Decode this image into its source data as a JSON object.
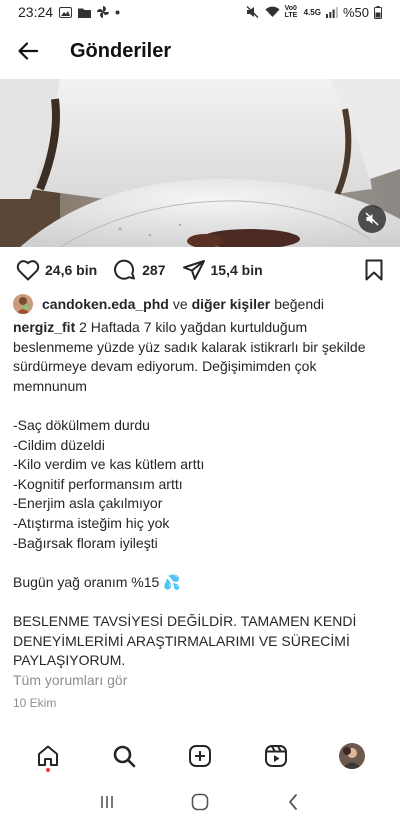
{
  "status_bar": {
    "time": "23:24",
    "carrier_label": "Vo0 LTE",
    "network": "4.5G",
    "battery": "%50"
  },
  "header": {
    "title": "Gönderiler"
  },
  "actions": {
    "likes": "24,6 bin",
    "comments": "287",
    "shares": "15,4 bin"
  },
  "likes_line": {
    "user": "candoken.eda_phd",
    "conjunction": "ve",
    "others": "diğer kişiler",
    "suffix": "beğendi"
  },
  "caption": {
    "username": "nergiz_fit",
    "text": " 2 Haftada 7 kilo yağdan kurtulduğum beslenmeme yüzde yüz sadık kalarak istikrarlı bir şekilde sürdürmeye devam ediyorum. Değişimimden çok memnunum\n\n-Saç dökülmem durdu\n-Cildim düzeldi\n-Kilo verdim ve kas kütlem arttı\n-Kognitif performansım arttı\n-Enerjim asla çakılmıyor\n-Atıştırma isteğim hiç yok\n-Bağırsak floram iyileşti\n\nBugün yağ oranım %15 💦\n\nBESLENME TAVSİYESİ DEĞİLDİR. TAMAMEN KENDİ DENEYİMLERİMİ ARAŞTIRMALARIMI VE SÜRECİMİ PAYLAŞIYORUM."
  },
  "comments_link": "Tüm yorumları gör",
  "date": "10 Ekim",
  "icons": {
    "back": "arrow-left-icon",
    "like": "heart-icon",
    "comment": "comment-bubble-icon",
    "share": "paper-plane-icon",
    "save": "bookmark-icon",
    "mute": "speaker-muted-icon",
    "nav": [
      "home-icon",
      "search-icon",
      "create-icon",
      "reels-icon",
      "profile-avatar"
    ]
  },
  "colors": {
    "text": "#262626",
    "secondary": "#8e8e8e",
    "notification": "#ff3040"
  }
}
